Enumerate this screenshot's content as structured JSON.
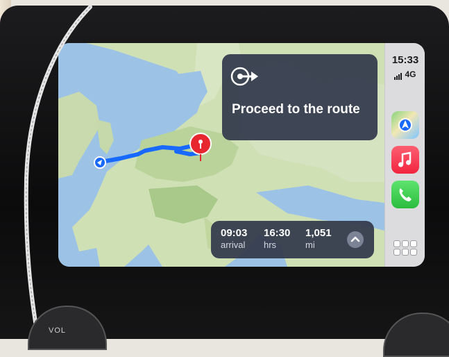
{
  "status_bar": {
    "time": "15:33",
    "network": "4G"
  },
  "dock": {
    "apps": [
      {
        "name": "Maps",
        "icon": "maps-icon"
      },
      {
        "name": "Music",
        "icon": "music-icon"
      },
      {
        "name": "Phone",
        "icon": "phone-icon"
      }
    ],
    "home_icon": "app-grid-icon"
  },
  "route_card": {
    "instruction": "Proceed to the route",
    "icon": "turn-right-arrow-icon"
  },
  "trip_summary": {
    "arrival": {
      "value": "09:03",
      "label": "arrival"
    },
    "duration": {
      "value": "16:30",
      "label": "hrs"
    },
    "distance": {
      "value": "1,051",
      "label": "mi"
    },
    "expand_icon": "chevron-up-icon"
  },
  "hardware": {
    "volume_label": "VOL"
  },
  "colors": {
    "route": "#1769ff",
    "pin": "#e8262f",
    "panel": "#343a4c"
  }
}
